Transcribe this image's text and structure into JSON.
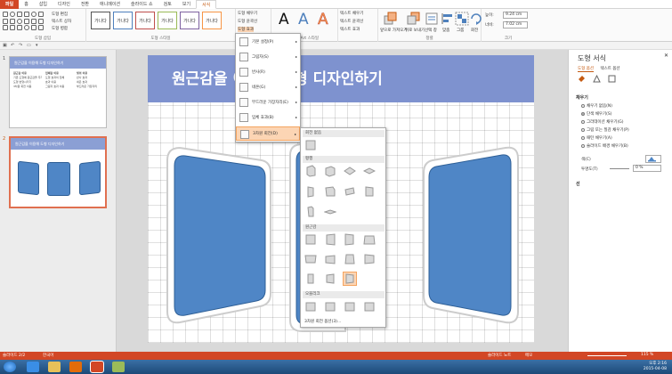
{
  "tabs": [
    "파일",
    "홈",
    "삽입",
    "디자인",
    "전환",
    "애니메이션",
    "슬라이드 쇼",
    "검토",
    "보기",
    "서식"
  ],
  "ribbon": {
    "insert_shapes_label": "도형 삽입",
    "edit_shape": "도형 편집",
    "text_box": "텍스트 상자",
    "merge_shapes": "도형 병합",
    "shape_styles_label": "도형 스타일",
    "style_thumb_text": "가나다",
    "shape_fill": "도형 채우기",
    "shape_outline": "도형 윤곽선",
    "shape_effects": "도형 효과",
    "wordart_label": "WordArt 스타일",
    "wordart_glyph": "A",
    "text_fill": "텍스트 채우기",
    "text_outline": "텍스트 윤곽선",
    "text_effects": "텍스트 효과",
    "bring_forward": "앞으로 가져오기",
    "send_backward": "뒤로 보내기",
    "selection_pane": "선택 창",
    "align": "맞춤",
    "group": "그룹",
    "rotate": "회전",
    "arrange_label": "정렬",
    "size_label": "크기",
    "height_label": "높이:",
    "height_value": "9.24 cm",
    "width_label": "너비:",
    "width_value": "7.02 cm"
  },
  "thumbnails": [
    {
      "num": "1",
      "title": "원근감을 이용해 도형 디자인하기",
      "cols": [
        {
          "head": "원근감 이용",
          "lines": [
            "기존 도형에 원근감을 주기",
            "도형 변형시키기",
            "3차원 회전 이용"
          ]
        },
        {
          "head": "입체감 이용",
          "lines": [
            "도형 효과의 입체",
            "효과 이용",
            "그림자 효과 이용"
          ]
        },
        {
          "head": "빛의 이용",
          "lines": [
            "반사 효과",
            "네온 효과",
            "부드러운 가장자리"
          ]
        }
      ]
    },
    {
      "num": "2",
      "title": "원근감을 이용해 도형 디자인하기"
    }
  ],
  "slide": {
    "title": "원근감을 이용해 도형 디자인하기"
  },
  "menu": {
    "items": [
      {
        "label": "기본 설정(P)"
      },
      {
        "label": "그림자(S)"
      },
      {
        "label": "반사(R)"
      },
      {
        "label": "네온(G)"
      },
      {
        "label": "부드러운 가장자리(E)"
      },
      {
        "label": "입체 효과(B)"
      },
      {
        "label": "3차원 회전(D)"
      }
    ]
  },
  "submenu": {
    "no_rotation": "회전 없음",
    "parallel": "평행",
    "perspective": "원근감",
    "oblique": "오블리크",
    "options": "3차원 회전 옵션(3)..."
  },
  "rpane": {
    "title": "도형 서식",
    "tab_shape": "도형 옵션",
    "tab_text": "텍스트 옵션",
    "fill_section": "채우기",
    "fill_options": [
      {
        "label": "채우기 없음(N)",
        "on": false
      },
      {
        "label": "단색 채우기(S)",
        "on": true
      },
      {
        "label": "그라데이션 채우기(G)",
        "on": false
      },
      {
        "label": "그림 또는 질감 채우기(P)",
        "on": false
      },
      {
        "label": "패턴 채우기(A)",
        "on": false
      },
      {
        "label": "슬라이드 배경 채우기(B)",
        "on": false
      }
    ],
    "color_label": "색(C)",
    "transparency_label": "투명도(T)",
    "transparency_value": "0 %",
    "line_section": "선"
  },
  "status": {
    "slide": "슬라이드 2/2",
    "language": "한국어",
    "notes": "슬라이드 노트",
    "comments": "메모",
    "zoom": "115 %"
  },
  "clock": {
    "time": "오후 2:16",
    "date": "2015-04-08"
  },
  "colors": {
    "accent": "#d24726",
    "slide_header": "#7e92cf",
    "shape_fill": "#4f86c6"
  }
}
